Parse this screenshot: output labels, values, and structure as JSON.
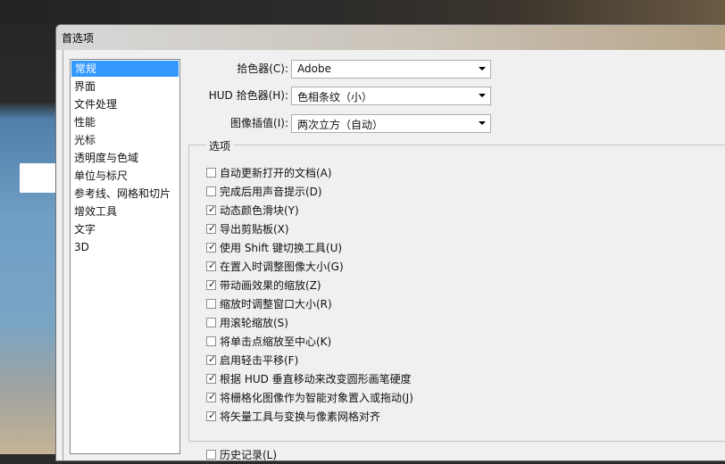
{
  "dialog_title": "首选项",
  "categories": [
    {
      "label": "常规",
      "selected": true
    },
    {
      "label": "界面",
      "selected": false
    },
    {
      "label": "文件处理",
      "selected": false
    },
    {
      "label": "性能",
      "selected": false
    },
    {
      "label": "光标",
      "selected": false
    },
    {
      "label": "透明度与色域",
      "selected": false
    },
    {
      "label": "单位与标尺",
      "selected": false
    },
    {
      "label": "参考线、网格和切片",
      "selected": false
    },
    {
      "label": "增效工具",
      "selected": false
    },
    {
      "label": "文字",
      "selected": false
    },
    {
      "label": "3D",
      "selected": false
    }
  ],
  "fields": {
    "color_picker": {
      "label": "拾色器(C):",
      "value": "Adobe"
    },
    "hud_color_picker": {
      "label": "HUD 拾色器(H):",
      "value": "色相条纹（小）"
    },
    "interpolation": {
      "label": "图像插值(I):",
      "value": "两次立方（自动）"
    }
  },
  "options_group_title": "选项",
  "options": [
    {
      "label": "自动更新打开的文档(A)",
      "checked": false
    },
    {
      "label": "完成后用声音提示(D)",
      "checked": false
    },
    {
      "label": "动态颜色滑块(Y)",
      "checked": true
    },
    {
      "label": "导出剪贴板(X)",
      "checked": true
    },
    {
      "label": "使用 Shift 键切换工具(U)",
      "checked": true
    },
    {
      "label": "在置入时调整图像大小(G)",
      "checked": true
    },
    {
      "label": "带动画效果的缩放(Z)",
      "checked": true
    },
    {
      "label": "缩放时调整窗口大小(R)",
      "checked": false
    },
    {
      "label": "用滚轮缩放(S)",
      "checked": false
    },
    {
      "label": "将单击点缩放至中心(K)",
      "checked": false
    },
    {
      "label": "启用轻击平移(F)",
      "checked": true
    },
    {
      "label": "根据 HUD 垂直移动来改变圆形画笔硬度",
      "checked": true
    },
    {
      "label": "将栅格化图像作为智能对象置入或拖动(J)",
      "checked": true
    },
    {
      "label": "将矢量工具与变换与像素网格对齐",
      "checked": true
    }
  ],
  "partial_option": {
    "label": "历史记录(L)",
    "checked": false
  }
}
